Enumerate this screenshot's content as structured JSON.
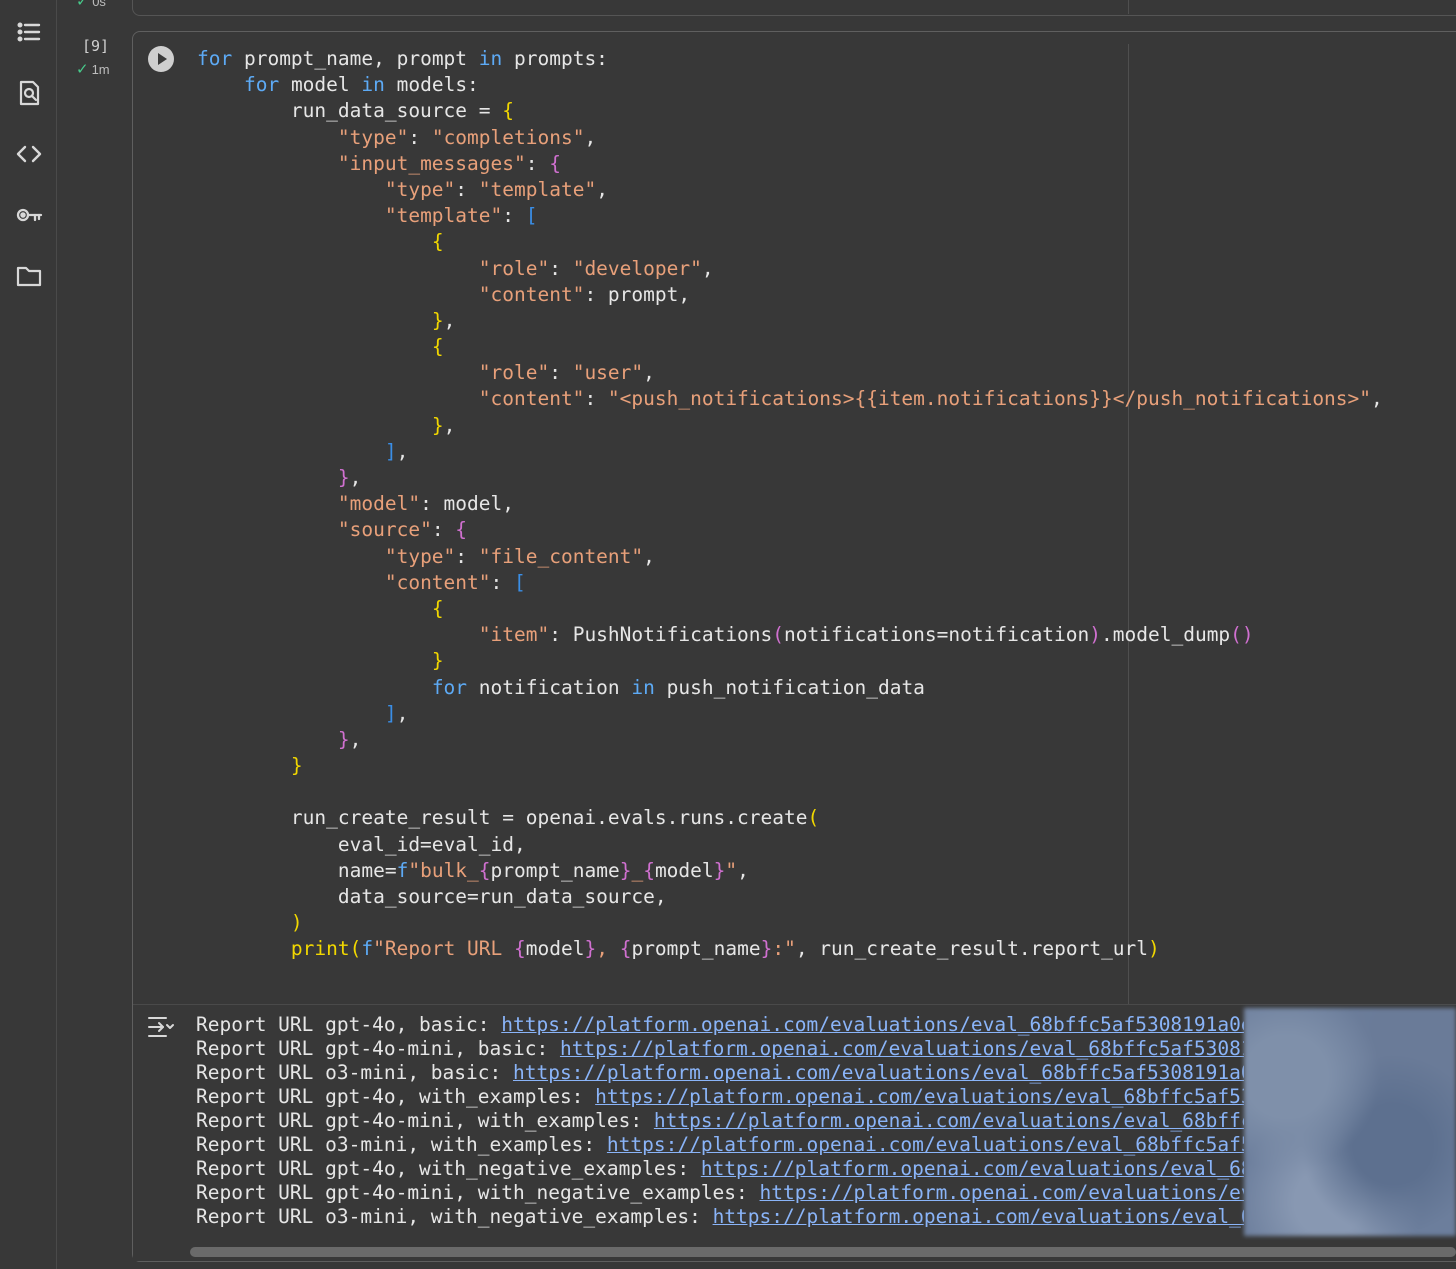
{
  "sidebar": {
    "items": [
      {
        "icon": "table-of-contents-icon"
      },
      {
        "icon": "find-replace-icon"
      },
      {
        "icon": "code-snippets-icon"
      },
      {
        "icon": "secrets-key-icon"
      },
      {
        "icon": "files-folder-icon"
      }
    ]
  },
  "prev_cell": {
    "exec_time": "0s"
  },
  "cell": {
    "exec_count": "[9]",
    "exec_time": "1m"
  },
  "code_lines": [
    "<span class=\"k\">for</span> prompt_name, prompt <span class=\"k\">in</span> prompts:",
    "    <span class=\"k\">for</span> model <span class=\"k\">in</span> models:",
    "        run_data_source = <span class=\"b1\">{</span>",
    "            <span class=\"s\">\"type\"</span>: <span class=\"s\">\"completions\"</span>,",
    "            <span class=\"s\">\"input_messages\"</span>: <span class=\"b2\">{</span>",
    "                <span class=\"s\">\"type\"</span>: <span class=\"s\">\"template\"</span>,",
    "                <span class=\"s\">\"template\"</span>: <span class=\"b3\">[</span>",
    "                    <span class=\"b1\">{</span>",
    "                        <span class=\"s\">\"role\"</span>: <span class=\"s\">\"developer\"</span>,",
    "                        <span class=\"s\">\"content\"</span>: prompt,",
    "                    <span class=\"b1\">}</span>,",
    "                    <span class=\"b1\">{</span>",
    "                        <span class=\"s\">\"role\"</span>: <span class=\"s\">\"user\"</span>,",
    "                        <span class=\"s\">\"content\"</span>: <span class=\"s\">\"&lt;push_notifications&gt;{{item.notifications}}&lt;/push_notifications&gt;\"</span>,",
    "                    <span class=\"b1\">}</span>,",
    "                <span class=\"b3\">]</span>,",
    "            <span class=\"b2\">}</span>,",
    "            <span class=\"s\">\"model\"</span>: model,",
    "            <span class=\"s\">\"source\"</span>: <span class=\"b2\">{</span>",
    "                <span class=\"s\">\"type\"</span>: <span class=\"s\">\"file_content\"</span>,",
    "                <span class=\"s\">\"content\"</span>: <span class=\"b3\">[</span>",
    "                    <span class=\"b1\">{</span>",
    "                        <span class=\"s\">\"item\"</span>: PushNotifications<span class=\"b2\">(</span>notifications=notification<span class=\"b2\">)</span>.model_dump<span class=\"b2\">()</span>",
    "                    <span class=\"b1\">}</span>",
    "                    <span class=\"k\">for</span> notification <span class=\"k\">in</span> push_notification_data",
    "                <span class=\"b3\">]</span>,",
    "            <span class=\"b2\">}</span>,",
    "        <span class=\"b1\">}</span>",
    "",
    "        run_create_result = openai.evals.runs.create<span class=\"b1\">(</span>",
    "            eval_id=eval_id,",
    "            name=<span class=\"k\">f</span><span class=\"s\">\"bulk_</span><span class=\"b2\">{</span>prompt_name<span class=\"b2\">}</span><span class=\"s\">_</span><span class=\"b2\">{</span>model<span class=\"b2\">}</span><span class=\"s\">\"</span>,",
    "            data_source=run_data_source,",
    "        <span class=\"b1\">)</span>",
    "        <span class=\"b1\">print(</span><span class=\"k\">f</span><span class=\"s\">\"Report URL </span><span class=\"b2\">{</span>model<span class=\"b2\">}</span><span class=\"s\">, </span><span class=\"b2\">{</span>prompt_name<span class=\"b2\">}</span><span class=\"s\">:\"</span>, run_create_result.report_url<span class=\"b1\">)</span>"
  ],
  "output": {
    "lines": [
      {
        "prefix": "Report URL gpt-4o, basic: ",
        "url": "https://platform.openai.com/evaluations/eval_68bffc5af5308191a0e"
      },
      {
        "prefix": "Report URL gpt-4o-mini, basic: ",
        "url": "https://platform.openai.com/evaluations/eval_68bffc5af53081"
      },
      {
        "prefix": "Report URL o3-mini, basic: ",
        "url": "https://platform.openai.com/evaluations/eval_68bffc5af5308191a0"
      },
      {
        "prefix": "Report URL gpt-4o, with_examples: ",
        "url": "https://platform.openai.com/evaluations/eval_68bffc5af53"
      },
      {
        "prefix": "Report URL gpt-4o-mini, with_examples: ",
        "url": "https://platform.openai.com/evaluations/eval_68bffc"
      },
      {
        "prefix": "Report URL o3-mini, with_examples: ",
        "url": "https://platform.openai.com/evaluations/eval_68bffc5af5"
      },
      {
        "prefix": "Report URL gpt-4o, with_negative_examples: ",
        "url": "https://platform.openai.com/evaluations/eval_68"
      },
      {
        "prefix": "Report URL gpt-4o-mini, with_negative_examples: ",
        "url": "https://platform.openai.com/evaluations/ev"
      },
      {
        "prefix": "Report URL o3-mini, with_negative_examples: ",
        "url": "https://platform.openai.com/evaluations/eval_6"
      }
    ]
  },
  "colors": {
    "keyword": "#5daaf5",
    "string": "#e8a07a",
    "bracket_l1": "#f1d700",
    "bracket_l2": "#d070d0",
    "bracket_l3": "#3a8ee6",
    "link": "#8ab4f8",
    "check": "#47c98a"
  }
}
